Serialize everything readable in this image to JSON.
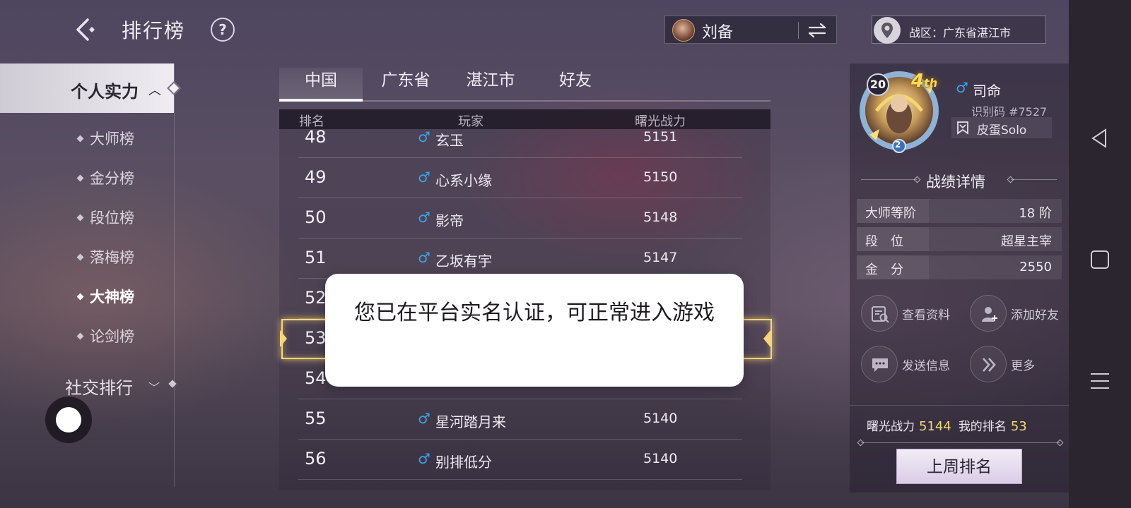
{
  "header": {
    "title": "排行榜",
    "help_label": "?",
    "player_name": "刘备",
    "region_text": "战区：广东省湛江市"
  },
  "nav": {
    "active_section": "个人实力",
    "items": [
      {
        "label": "大师榜",
        "current": false
      },
      {
        "label": "金分榜",
        "current": false
      },
      {
        "label": "段位榜",
        "current": false
      },
      {
        "label": "落梅榜",
        "current": false
      },
      {
        "label": "大神榜",
        "current": true
      },
      {
        "label": "论剑榜",
        "current": false
      }
    ],
    "social_section": "社交排行"
  },
  "tabs": [
    {
      "label": "中国",
      "active": true
    },
    {
      "label": "广东省",
      "active": false
    },
    {
      "label": "湛江市",
      "active": false
    },
    {
      "label": "好友",
      "active": false
    }
  ],
  "table": {
    "columns": [
      "排名",
      "玩家",
      "曙光战力"
    ],
    "rows": [
      {
        "rank": "48",
        "gender": "♂",
        "name": "玄玉",
        "score": "5151"
      },
      {
        "rank": "49",
        "gender": "♂",
        "name": "心系小缘",
        "score": "5150"
      },
      {
        "rank": "50",
        "gender": "♂",
        "name": "影帝",
        "score": "5148"
      },
      {
        "rank": "51",
        "gender": "♂",
        "name": "乙坂有宇",
        "score": "5147"
      },
      {
        "rank": "52",
        "gender": "",
        "name": "",
        "score": ""
      },
      {
        "rank": "53",
        "gender": "",
        "name": "",
        "score": ""
      },
      {
        "rank": "54",
        "gender": "",
        "name": "",
        "score": ""
      },
      {
        "rank": "55",
        "gender": "♂",
        "name": "星河踏月来",
        "score": "5140"
      },
      {
        "rank": "56",
        "gender": "♂",
        "name": "别排低分",
        "score": "5140"
      }
    ],
    "highlighted_rank": "53"
  },
  "toast": {
    "message": "您已在平台实名认证，可正常进入游戏"
  },
  "profile": {
    "level": "20",
    "rank_badge": "4",
    "rank_suffix": "th",
    "frame_level": "2",
    "gender": "♂",
    "name": "司命",
    "id_text": "识别码 #7527",
    "club": "皮蛋Solo",
    "section_title": "战绩详情",
    "stats": [
      {
        "key": "大师等阶",
        "value": "18 阶"
      },
      {
        "key": "段　位",
        "value": "超星主宰"
      },
      {
        "key": "金　分",
        "value": "2550"
      }
    ],
    "actions": {
      "view_profile": "查看资料",
      "add_friend": "添加好友",
      "send_message": "发送信息",
      "more": "更多"
    },
    "summary": {
      "power_label": "曙光战力",
      "power_value": "5144",
      "rank_label": "我的排名",
      "rank_value": "53"
    },
    "last_week_button": "上周排名"
  },
  "colors": {
    "accent_gold": "#f5d77a",
    "male_blue": "#3aa3ea",
    "summary_value": "#f0d97a"
  }
}
